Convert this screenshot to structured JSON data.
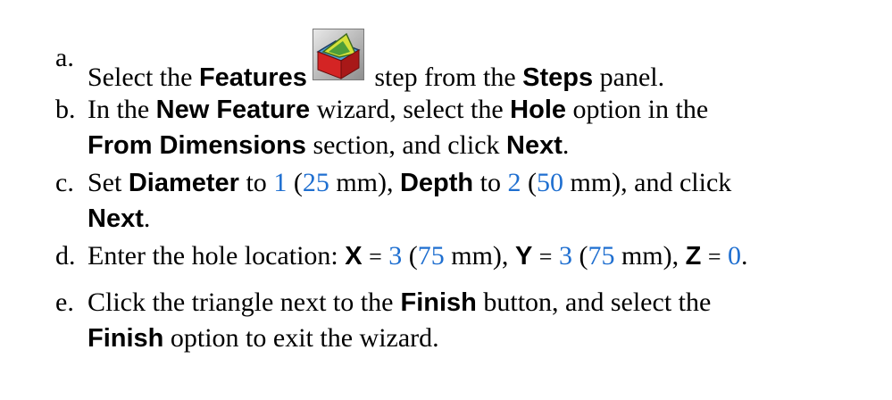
{
  "steps": [
    {
      "marker": "a.",
      "line1": {
        "t1": "Select the",
        "b1": "Features",
        "t2": "step from the",
        "b2": "Steps",
        "t3": "panel."
      }
    },
    {
      "marker": "b.",
      "line1": {
        "t1": "In the",
        "b1": "New Feature",
        "t2": "wizard, select the",
        "b2": "Hole",
        "t3": "option in the"
      },
      "line2": {
        "b1": "From Dimensions",
        "t1": "section, and click",
        "b2": "Next",
        "t2": "."
      }
    },
    {
      "marker": "c.",
      "line1": {
        "t1": "Set",
        "b1": "Diameter",
        "t2": "to",
        "v1": "1",
        "t3": "(",
        "v2": "25",
        "t4": "mm),",
        "b2": "Depth",
        "t5": "to",
        "v3": "2",
        "t6": "(",
        "v4": "50",
        "t7": "mm), and click"
      },
      "line2": {
        "b1": "Next",
        "t1": "."
      }
    },
    {
      "marker": "d.",
      "line1": {
        "t1": "Enter the hole location:",
        "b1": "X",
        "eq1": "=",
        "v1": "3",
        "t2": "(",
        "v2": "75",
        "t3": "mm),",
        "b2": "Y",
        "eq2": "=",
        "v3": "3",
        "t4": "(",
        "v4": "75",
        "t5": "mm),",
        "b3": "Z",
        "eq3": "=",
        "v5": "0",
        "t6": "."
      }
    },
    {
      "marker": "e.",
      "line1": {
        "t1": "Click the triangle next to the",
        "b1": "Finish",
        "t2": "button, and select the"
      },
      "line2": {
        "b1": "Finish",
        "t1": "option to exit the wizard."
      }
    }
  ],
  "icons": {
    "features": "features-step-icon"
  },
  "colors": {
    "value_blue": "#1f6fd0",
    "text": "#000000"
  }
}
